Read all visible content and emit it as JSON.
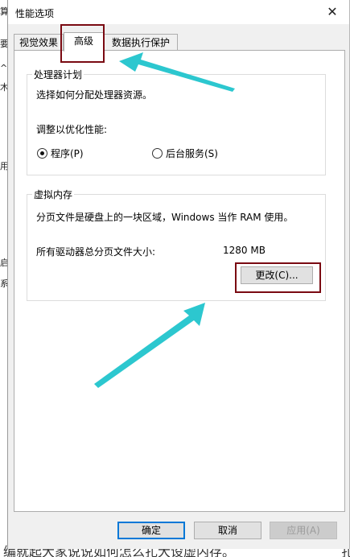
{
  "dialog": {
    "title": "性能选项",
    "close_glyph": "✕"
  },
  "tabs": [
    {
      "label": "视觉效果"
    },
    {
      "label": "高级"
    },
    {
      "label": "数据执行保护"
    }
  ],
  "processor": {
    "title": "处理器计划",
    "desc": "选择如何分配处理器资源。",
    "adjust_label": "调整以优化性能:",
    "options": [
      {
        "label": "程序(P)",
        "selected": true
      },
      {
        "label": "后台服务(S)",
        "selected": false
      }
    ]
  },
  "virtual_memory": {
    "title": "虚拟内存",
    "desc": "分页文件是硬盘上的一块区域，Windows 当作 RAM 使用。",
    "size_label": "所有驱动器总分页文件大小:",
    "size_value": "1280 MB",
    "change_button": "更改(C)..."
  },
  "footer": {
    "ok": "确定",
    "cancel": "取消",
    "apply": "应用(A)"
  },
  "background": {
    "side_chars": [
      "算",
      "要",
      "^",
      "木",
      "用",
      "启",
      "系"
    ],
    "bottom_left": "编就起大家说说如何怎么扎大设虚内存。",
    "bottom_right": "扎"
  },
  "annotation": {
    "highlight_color": "#7a0a12",
    "arrow_color": "#2cc7cf"
  }
}
